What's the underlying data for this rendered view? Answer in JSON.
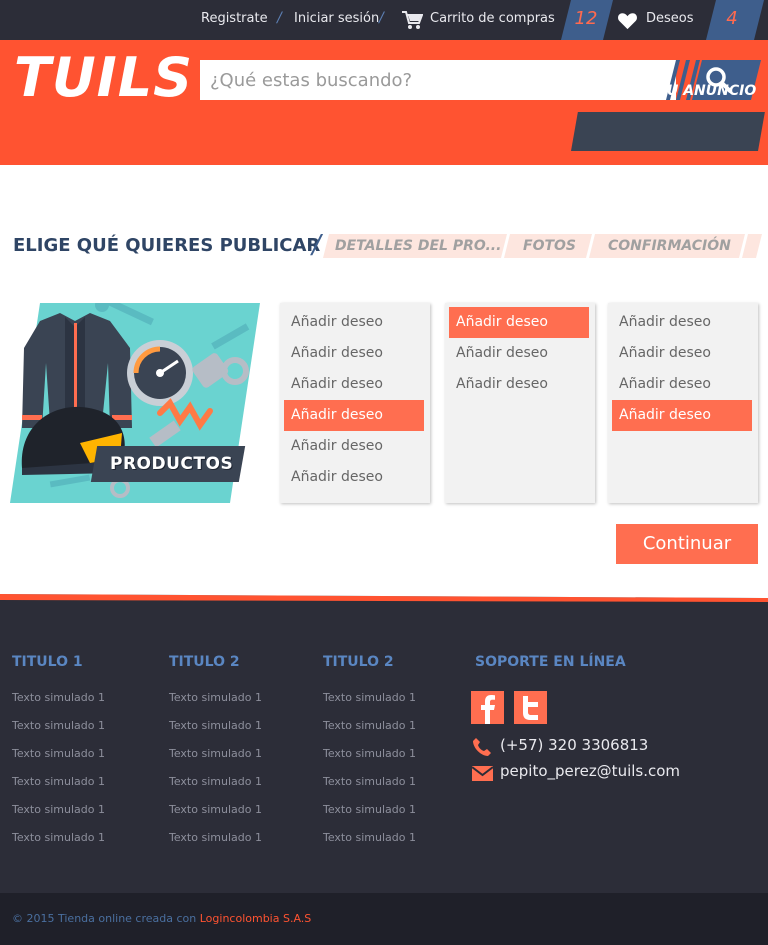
{
  "topbar": {
    "register": "Registrate",
    "login": "Iniciar sesión",
    "cart_label": "Carrito de compras",
    "cart_count": "12",
    "wishlist_label": "Deseos",
    "wishlist_count": "4",
    "separator": "/"
  },
  "header": {
    "logo": "TUILS",
    "search_placeholder": "¿Qué estas buscando?",
    "publish_label": "PUBLICA TU ANUNCIO"
  },
  "steps": {
    "current": "ELIGE QUÉ QUIERES PUBLICAR",
    "items": [
      "DETALLES DEL PRO...",
      "FOTOS",
      "CONFIRMACIÓN"
    ]
  },
  "category": {
    "label": "PRODUCTOS"
  },
  "columns": [
    {
      "options": [
        {
          "label": "Añadir deseo",
          "active": false
        },
        {
          "label": "Añadir deseo",
          "active": false
        },
        {
          "label": "Añadir deseo",
          "active": false
        },
        {
          "label": "Añadir deseo",
          "active": true
        },
        {
          "label": "Añadir deseo",
          "active": false
        },
        {
          "label": "Añadir deseo",
          "active": false
        }
      ]
    },
    {
      "options": [
        {
          "label": "Añadir deseo",
          "active": true
        },
        {
          "label": "Añadir deseo",
          "active": false
        },
        {
          "label": "Añadir deseo",
          "active": false
        }
      ]
    },
    {
      "options": [
        {
          "label": "Añadir deseo",
          "active": false
        },
        {
          "label": "Añadir deseo",
          "active": false
        },
        {
          "label": "Añadir deseo",
          "active": false
        },
        {
          "label": "Añadir deseo",
          "active": true
        }
      ]
    }
  ],
  "continue_label": "Continuar",
  "footer": {
    "columns": [
      {
        "title": "TITULO 1",
        "links": [
          "Texto simulado 1",
          "Texto simulado 1",
          "Texto simulado 1",
          "Texto simulado 1",
          "Texto simulado 1",
          "Texto simulado 1"
        ]
      },
      {
        "title": "TITULO 2",
        "links": [
          "Texto simulado 1",
          "Texto simulado 1",
          "Texto simulado 1",
          "Texto simulado 1",
          "Texto simulado 1",
          "Texto simulado 1"
        ]
      },
      {
        "title": "TITULO 2",
        "links": [
          "Texto simulado 1",
          "Texto simulado 1",
          "Texto simulado 1",
          "Texto simulado 1",
          "Texto simulado 1",
          "Texto simulado 1"
        ]
      }
    ],
    "support_title": "SOPORTE EN LÍNEA",
    "social": [
      "facebook-icon",
      "twitter-icon"
    ],
    "phone": "(+57) 320 3306813",
    "email": "pepito_perez@tuils.com",
    "copyright_prefix": "© 2015 Tienda online creada con ",
    "copyright_company": "Logincolombia S.A.S"
  },
  "colors": {
    "brand_orange": "#ff5331",
    "accent_orange": "#ff6e50",
    "navy": "#3e5e8c",
    "dark": "#2c2d38"
  }
}
